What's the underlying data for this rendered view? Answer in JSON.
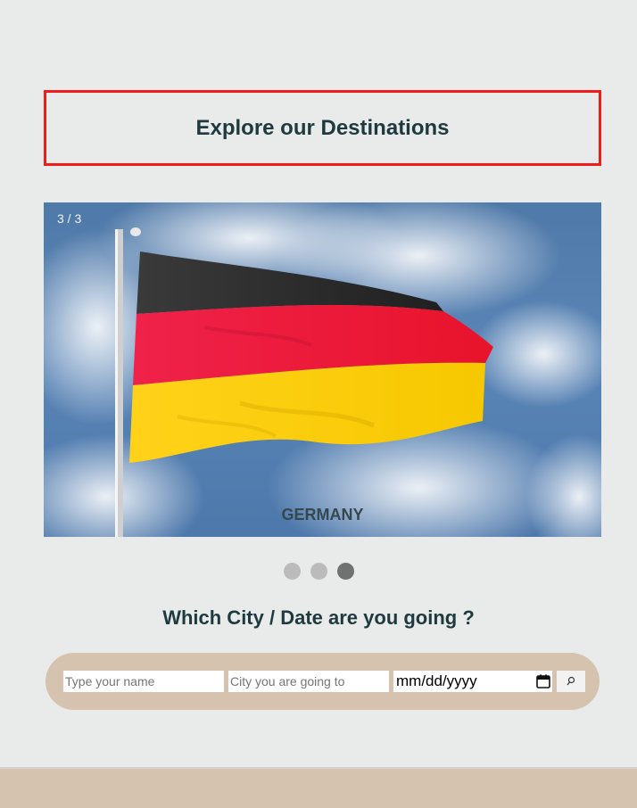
{
  "header": {
    "title": "Explore our Destinations"
  },
  "slider": {
    "counter": "3 / 3",
    "caption": "GERMANY",
    "slide_count": 3,
    "active_index": 2
  },
  "question": "Which City / Date are you going ?",
  "form": {
    "name_placeholder": "Type your name",
    "city_placeholder": "City you are going to",
    "date_value": "mm/dd/yyyy",
    "search_icon": "search-icon",
    "calendar_icon": "calendar-icon"
  },
  "colors": {
    "title_border": "#ee1c1c",
    "heading_text": "#1f3a3f",
    "form_background": "#d6c3af",
    "dot_inactive": "#bbbbbb",
    "dot_active": "#717171"
  }
}
